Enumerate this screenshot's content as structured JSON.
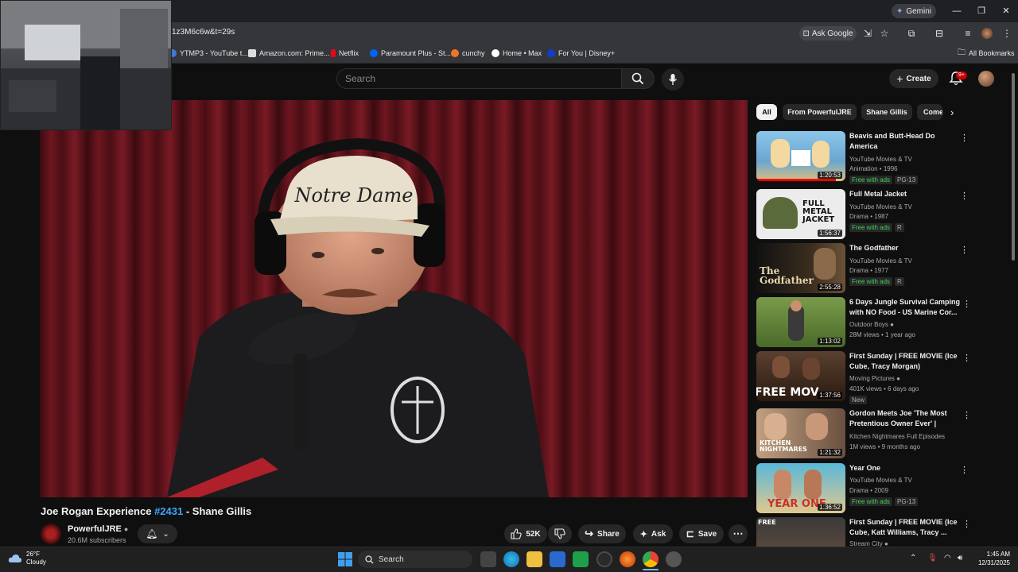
{
  "browser": {
    "gemini_label": "Gemini",
    "url": "1z3M6c6w&t=29s",
    "ask_google_label": "Ask Google",
    "bookmarks": [
      {
        "label": "YTMP3 - YouTube t...",
        "color": "#3a7bd5"
      },
      {
        "label": "Amazon.com: Prime...",
        "color": "#dddddd"
      },
      {
        "label": "Netflix",
        "color": "#e50914"
      },
      {
        "label": "Paramount Plus - St...",
        "color": "#0064ff"
      },
      {
        "label": "cunchy",
        "color": "#f47521"
      },
      {
        "label": "Home • Max",
        "color": "#ffffff"
      },
      {
        "label": "For You | Disney+",
        "color": "#113ccf"
      }
    ],
    "all_bookmarks_label": "All Bookmarks"
  },
  "youtube": {
    "search_placeholder": "Search",
    "create_label": "Create",
    "notification_count": "9+",
    "video": {
      "title_prefix": "Joe Rogan Experience ",
      "title_tag": "#2431",
      "title_suffix": " - Shane Gillis",
      "channel_name": "PowerfulJRE",
      "subscribers": "20.6M subscribers",
      "like_count": "52K",
      "share_label": "Share",
      "ask_label": "Ask",
      "save_label": "Save",
      "cap_text": "Notre Dame"
    },
    "chips": [
      "All",
      "From PowerfulJRE",
      "Shane Gillis",
      "Comedy"
    ],
    "recommendations": [
      {
        "title": "Beavis and Butt-Head Do America",
        "channel": "YouTube Movies & TV",
        "meta": "Animation • 1996",
        "duration": "1:20:53",
        "free": "Free with ads",
        "rating": "PG-13",
        "thumb_color": "#7fb7e0"
      },
      {
        "title": "Full Metal Jacket",
        "channel": "YouTube Movies & TV",
        "meta": "Drama • 1987",
        "duration": "1:56:37",
        "free": "Free with ads",
        "rating": "R",
        "thumb_color": "#e8e8e8"
      },
      {
        "title": "The Godfather",
        "channel": "YouTube Movies & TV",
        "meta": "Drama • 1977",
        "duration": "2:55:28",
        "free": "Free with ads",
        "rating": "R",
        "thumb_color": "#2a2a2a"
      },
      {
        "title": "6 Days Jungle Survival Camping with NO Food - US Marine Cor...",
        "channel": "Outdoor Boys",
        "meta": "28M views • 1 year ago",
        "duration": "1:13:02",
        "thumb_color": "#5a7a3a"
      },
      {
        "title": "First Sunday | FREE MOVIE (Ice Cube, Tracy Morgan)",
        "channel": "Moving Pictures",
        "meta": "401K views • 6 days ago",
        "duration": "1:37:56",
        "badge": "New",
        "thumb_color": "#6a4a30"
      },
      {
        "title": "Gordon Meets Joe 'The Most Pretentious Owner Ever' | FULL...",
        "channel": "Kitchen Nightmares Full Episodes",
        "meta": "1M views • 9 months ago",
        "duration": "1:21:32",
        "thumb_color": "#8a6a50"
      },
      {
        "title": "Year One",
        "channel": "YouTube Movies & TV",
        "meta": "Drama • 2009",
        "duration": "1:36:52",
        "free": "Free with ads",
        "rating": "PG-13",
        "thumb_color": "#4aa0c0"
      },
      {
        "title": "First Sunday | FREE MOVIE (Ice Cube, Katt Williams, Tracy ...",
        "channel": "Stream City",
        "meta": "",
        "duration": "",
        "thumb_color": "#3a3a3a"
      }
    ]
  },
  "taskbar": {
    "temperature": "26°F",
    "condition": "Cloudy",
    "search_label": "Search",
    "time": "1:45 AM",
    "date": "12/31/2025"
  }
}
